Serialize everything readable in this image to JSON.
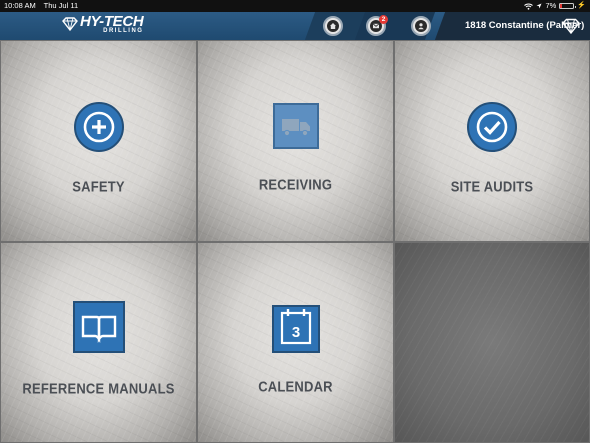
{
  "status_bar": {
    "time": "10:08 AM",
    "date": "Thu Jul 11",
    "battery": "7%"
  },
  "header": {
    "logo_main": "HY-TECH",
    "logo_sub": "DRILLING",
    "home_icon": "home-icon",
    "messages_icon": "message-icon",
    "messages_badge": "2",
    "profile_icon": "profile-icon",
    "site_name": "1818 Constantine (Palmer)",
    "colors": {
      "header_blue": "#2c5b85",
      "badge_red": "#e53935"
    }
  },
  "tiles": [
    {
      "label": "SAFETY",
      "icon": "plus-circle-icon"
    },
    {
      "label": "RECEIVING",
      "icon": "truck-icon"
    },
    {
      "label": "SITE AUDITS",
      "icon": "checkmark-circle-icon"
    },
    {
      "label": "REFERENCE MANUALS",
      "icon": "book-icon"
    },
    {
      "label": "CALENDAR",
      "icon": "calendar-icon",
      "calendar_day": "3"
    }
  ],
  "accent_color": "#2e73b5"
}
